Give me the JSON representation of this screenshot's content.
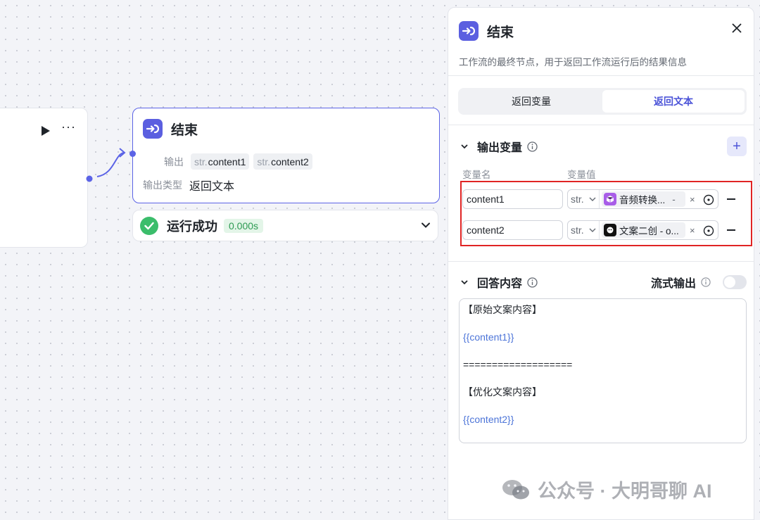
{
  "canvas": {
    "end_node": {
      "title": "结束",
      "output_label": "输出",
      "outputs": [
        {
          "type": "str.",
          "name": "content1"
        },
        {
          "type": "str.",
          "name": "content2"
        }
      ],
      "output_type_label": "输出类型",
      "output_type_value": "返回文本"
    },
    "run_status": {
      "text": "运行成功",
      "time": "0.000s"
    }
  },
  "panel": {
    "title": "结束",
    "description": "工作流的最终节点，用于返回工作流运行后的结果信息",
    "tabs": [
      {
        "label": "返回变量",
        "active": false
      },
      {
        "label": "返回文本",
        "active": true
      }
    ],
    "output_section": {
      "title": "输出变量",
      "col_name": "变量名",
      "col_value": "变量值",
      "rows": [
        {
          "name": "content1",
          "type": "str.",
          "ref": "音频转换...",
          "ref_suffix": "-",
          "icon": "cube-icon"
        },
        {
          "name": "content2",
          "type": "str.",
          "ref": "文案二创 - o...",
          "ref_suffix": "",
          "icon": "bot-icon"
        }
      ]
    },
    "answer_section": {
      "title": "回答内容",
      "stream_label": "流式输出",
      "stream_on": false,
      "lines": [
        "【原始文案内容】",
        "{{content1}}",
        "===================",
        "【优化文案内容】",
        "{{content2}}"
      ]
    }
  },
  "watermark": "公众号 · 大明哥聊 AI",
  "colors": {
    "accent": "#5b5fe0",
    "success": "#3bbd6b",
    "highlight_box": "#e02424"
  }
}
